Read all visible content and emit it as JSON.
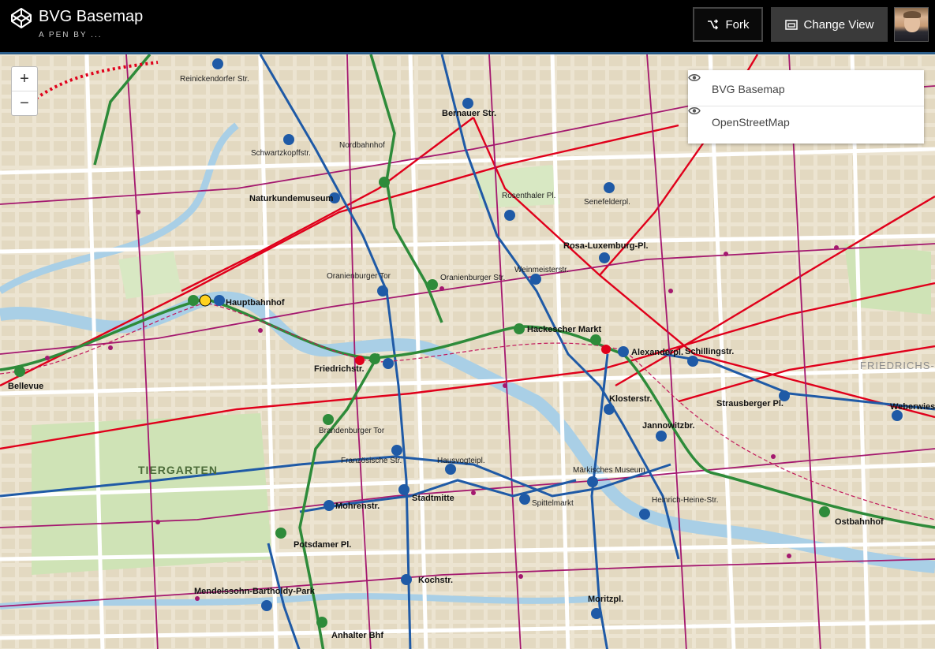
{
  "header": {
    "title": "BVG Basemap",
    "byline": "A PEN BY ...",
    "fork_label": "Fork",
    "change_view_label": "Change View"
  },
  "zoom": {
    "in": "+",
    "out": "−"
  },
  "layers": [
    {
      "label": "BVG Basemap",
      "icon": "eye-icon"
    },
    {
      "label": "OpenStreetMap",
      "icon": "eye-icon"
    }
  ],
  "map": {
    "districts": [
      "TIERGARTEN",
      "FRIEDRICHS-HAIN"
    ],
    "stations": [
      "Hauptbahnhof",
      "Friedrichstr.",
      "Hackescher Markt",
      "Alexanderpl.",
      "Oranienburger Tor",
      "Naturkundemuseum",
      "Rosenthaler Pl.",
      "Weinmeisterstr.",
      "Rosa-Luxemburg-Pl.",
      "Senefelderpl.",
      "Schwartzkopffstr.",
      "Bernauer Str.",
      "Nordbahnhof",
      "Oranienburger Str.",
      "Brandenburger Tor",
      "Französische Str.",
      "Hausvogteipl.",
      "Stadtmitte",
      "Spittelmarkt",
      "Märkisches Museum",
      "Heinrich-Heine-Str.",
      "Jannowitzbr.",
      "Klosterstr.",
      "Schillingstr.",
      "Strausberger Pl.",
      "Weberwiese",
      "Ostbahnhof",
      "Potsdamer Pl.",
      "Mohrenstr.",
      "Mendelssohn-Bartholdy-Park",
      "Anhalter Bhf",
      "Kochstr.",
      "Moritzpl.",
      "Bellevue",
      "Reinickendorfer Str."
    ]
  },
  "colors": {
    "s_bahn": "#2e8b3a",
    "u_bahn": "#1f5aa6",
    "tram": "#e0001b",
    "bus": "#a4186f",
    "water": "#a9cfe6",
    "park": "#cfe3b6"
  }
}
